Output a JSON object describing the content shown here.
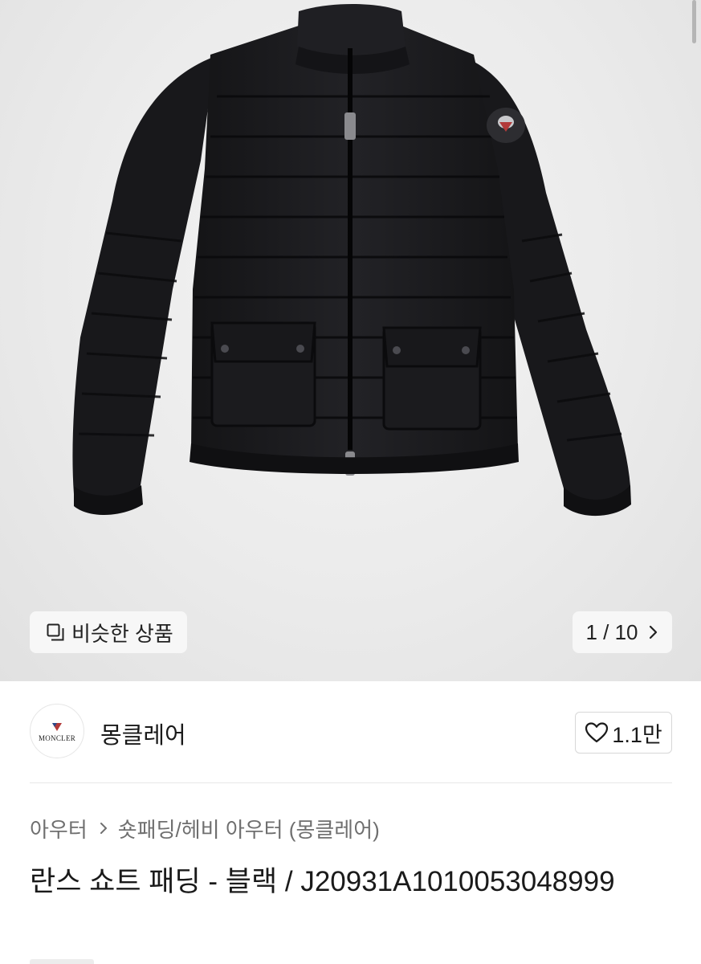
{
  "gallery": {
    "similar_label": "비슷한 상품",
    "counter": "1 / 10",
    "image_alt": "black short down jacket"
  },
  "shop": {
    "logo_text": "MONCLER",
    "name": "몽클레어",
    "favorite_count": "1.1만"
  },
  "breadcrumb": {
    "items": [
      "아우터",
      "숏패딩/헤비 아우터 (몽클레어)"
    ]
  },
  "product": {
    "title": "란스 쇼트 패딩 - 블랙 / J20931A1010053048999"
  },
  "icons": {
    "similar": "layers-icon",
    "next": "chevron-right-icon",
    "favorite": "heart-outline-icon",
    "crumb_sep": "chevron-right-icon"
  },
  "colors": {
    "jacket": "#1c1c1f",
    "background": "#ebebeb",
    "button_bg": "#f7f7f7",
    "muted_text": "#6f6f6f"
  }
}
